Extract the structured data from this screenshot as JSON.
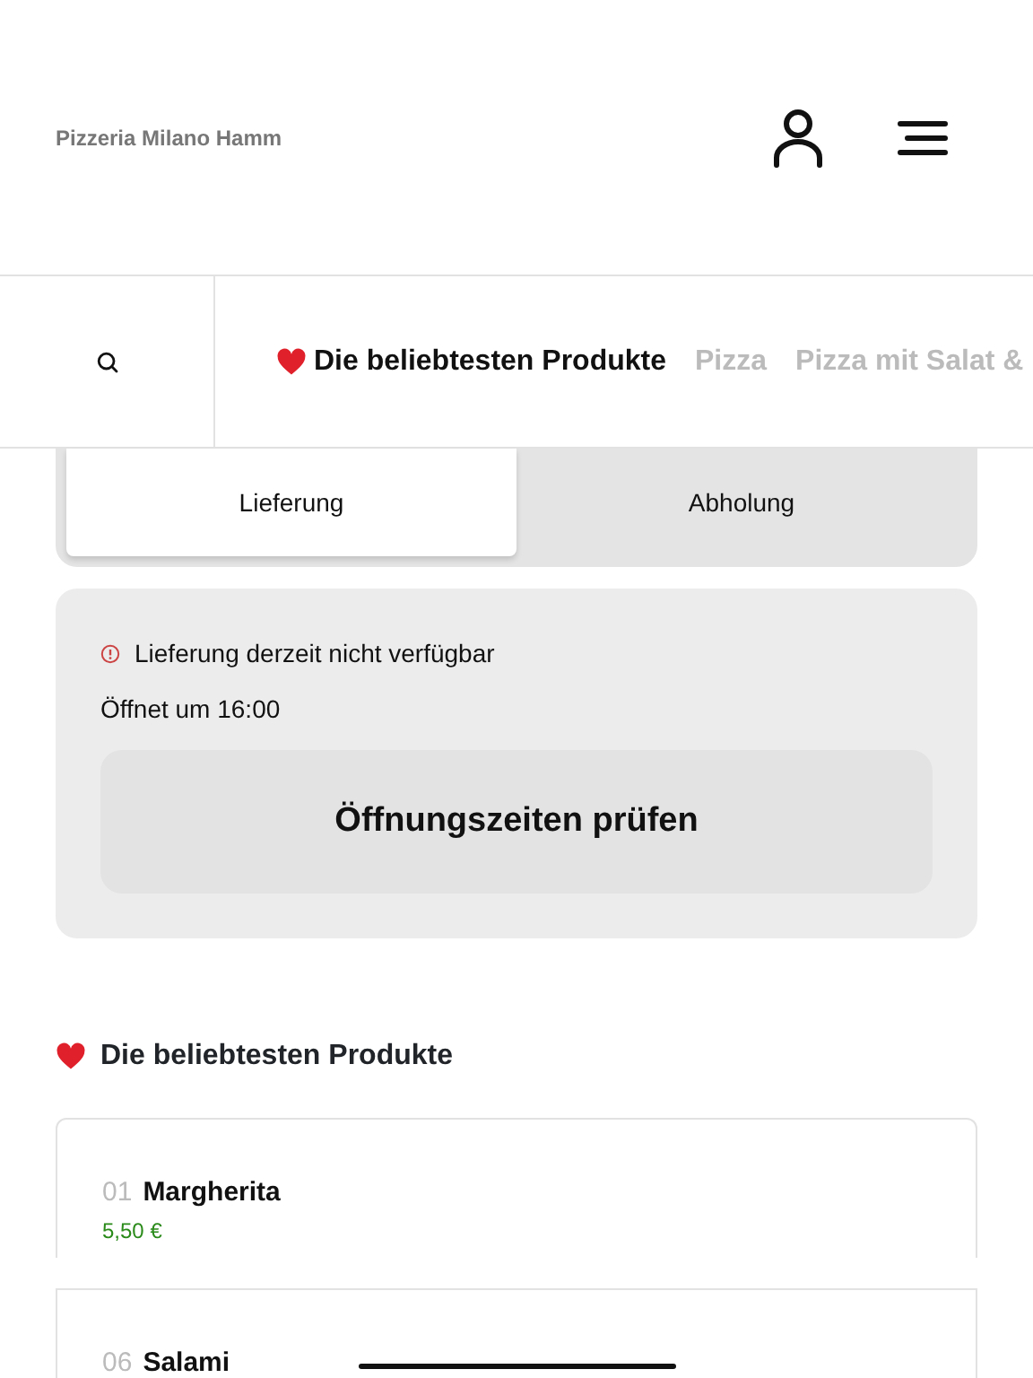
{
  "header": {
    "title": "Pizzeria Milano Hamm"
  },
  "categories": [
    {
      "label": "Die beliebtesten Produkte",
      "selected": true,
      "kind": "favorite"
    },
    {
      "label": "Pizza",
      "selected": false,
      "kind": "plain"
    },
    {
      "label": "Pizza mit Salat &",
      "selected": false,
      "kind": "plain"
    }
  ],
  "order_modes": [
    {
      "label": "Lieferung",
      "selected": true
    },
    {
      "label": "Abholung",
      "selected": false
    }
  ],
  "notice": {
    "message": "Lieferung derzeit nicht verfügbar",
    "opening": "Öffnet um 16:00",
    "button": "Öffnungszeiten prüfen"
  },
  "section": {
    "title": "Die beliebtesten Produkte"
  },
  "products": [
    {
      "number": "01",
      "name": "Margherita",
      "price": "5,50 €"
    },
    {
      "number": "06",
      "name": "Salami"
    }
  ]
}
